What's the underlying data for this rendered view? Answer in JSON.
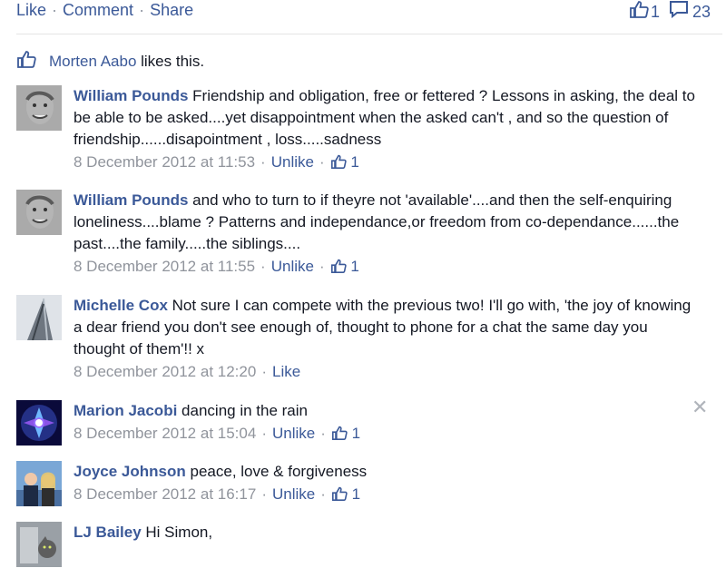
{
  "top": {
    "like": "Like",
    "comment": "Comment",
    "share": "Share",
    "like_count": "1",
    "comment_count": "23"
  },
  "likes_text": {
    "name": "Morten Aabo",
    "suffix": " likes this."
  },
  "comments": [
    {
      "author": "William Pounds",
      "text": "Friendship and obligation, free or fettered ? Lessons in asking, the deal to be able to be asked....yet disappointment when the asked can't , and so the question of friendship......disapointment , loss.....sadness",
      "time": "8 December 2012 at 11:53",
      "action": "Unlike",
      "likes": "1"
    },
    {
      "author": "William Pounds",
      "text": "and who to turn to if theyre not 'available'....and then the self-enquiring loneliness....blame ? Patterns and independance,or freedom from co-dependance......the past....the family.....the siblings....",
      "time": "8 December 2012 at 11:55",
      "action": "Unlike",
      "likes": "1"
    },
    {
      "author": "Michelle Cox",
      "text": "Not sure I can compete with the previous two! I'll go with, 'the joy of knowing a dear friend you don't see enough of, thought to phone for a chat the same day you thought of them'!! x",
      "time": "8 December 2012 at 12:20",
      "action": "Like",
      "likes": ""
    },
    {
      "author": "Marion Jacobi",
      "text": "dancing in the rain",
      "time": "8 December 2012 at 15:04",
      "action": "Unlike",
      "likes": "1"
    },
    {
      "author": "Joyce Johnson",
      "text": "peace, love & forgiveness",
      "time": "8 December 2012 at 16:17",
      "action": "Unlike",
      "likes": "1"
    },
    {
      "author": "LJ Bailey",
      "text": "Hi Simon,",
      "time": "",
      "action": "",
      "likes": ""
    }
  ],
  "colors": {
    "link": "#3b5998",
    "meta": "#90949c"
  }
}
